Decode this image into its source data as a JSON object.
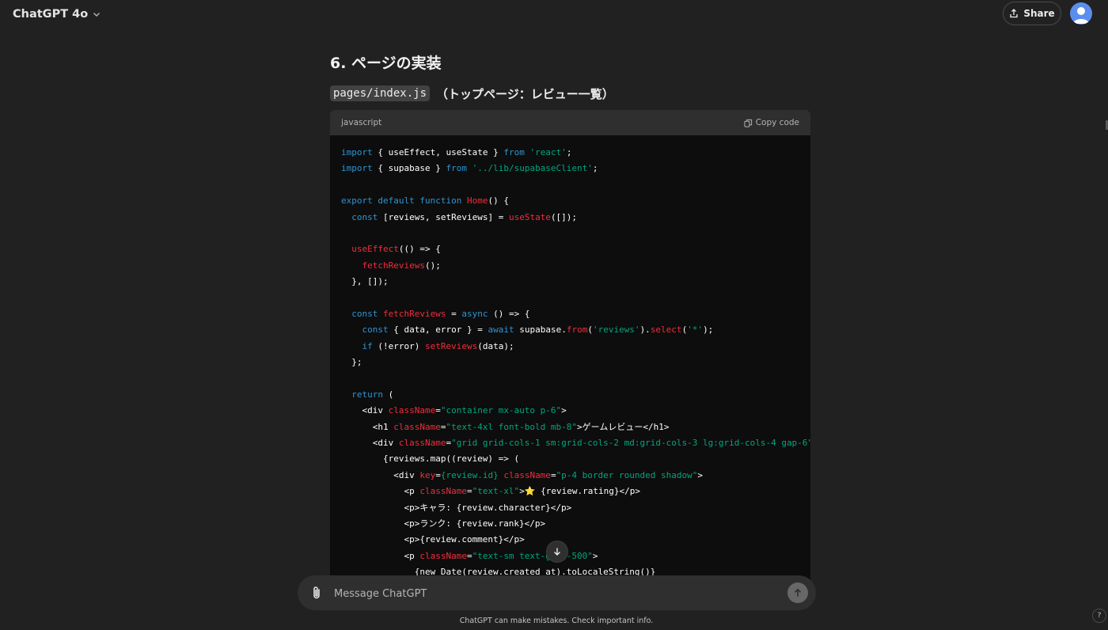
{
  "header": {
    "model_label": "ChatGPT 4o",
    "share_label": "Share"
  },
  "content": {
    "heading": "6. ページの実装",
    "file_name": "pages/index.js",
    "file_desc": "（トップページ：レビュー一覧）",
    "code_block": {
      "language": "javascript",
      "copy_label": "Copy code",
      "lines": [
        [
          [
            "kw",
            "import"
          ],
          [
            "pl",
            " { useEffect, useState } "
          ],
          [
            "kw",
            "from"
          ],
          [
            "pl",
            " "
          ],
          [
            "str",
            "'react'"
          ],
          [
            "pl",
            ";"
          ]
        ],
        [
          [
            "kw",
            "import"
          ],
          [
            "pl",
            " { supabase } "
          ],
          [
            "kw",
            "from"
          ],
          [
            "pl",
            " "
          ],
          [
            "str",
            "'../lib/supabaseClient'"
          ],
          [
            "pl",
            ";"
          ]
        ],
        [],
        [
          [
            "kw",
            "export"
          ],
          [
            "pl",
            " "
          ],
          [
            "kw",
            "default"
          ],
          [
            "pl",
            " "
          ],
          [
            "kw",
            "function"
          ],
          [
            "pl",
            " "
          ],
          [
            "fn",
            "Home"
          ],
          [
            "pl",
            "() {"
          ]
        ],
        [
          [
            "pl",
            "  "
          ],
          [
            "kw",
            "const"
          ],
          [
            "pl",
            " [reviews, setReviews] = "
          ],
          [
            "fn",
            "useState"
          ],
          [
            "pl",
            "([]);"
          ]
        ],
        [],
        [
          [
            "pl",
            "  "
          ],
          [
            "fn",
            "useEffect"
          ],
          [
            "pl",
            "(() => {"
          ]
        ],
        [
          [
            "pl",
            "    "
          ],
          [
            "fn",
            "fetchReviews"
          ],
          [
            "pl",
            "();"
          ]
        ],
        [
          [
            "pl",
            "  }, []);"
          ]
        ],
        [],
        [
          [
            "pl",
            "  "
          ],
          [
            "kw",
            "const"
          ],
          [
            "pl",
            " "
          ],
          [
            "fn",
            "fetchReviews"
          ],
          [
            "pl",
            " = "
          ],
          [
            "kw",
            "async"
          ],
          [
            "pl",
            " () => {"
          ]
        ],
        [
          [
            "pl",
            "    "
          ],
          [
            "kw",
            "const"
          ],
          [
            "pl",
            " { data, error } = "
          ],
          [
            "kw",
            "await"
          ],
          [
            "pl",
            " supabase."
          ],
          [
            "fn",
            "from"
          ],
          [
            "pl",
            "("
          ],
          [
            "str",
            "'reviews'"
          ],
          [
            "pl",
            ")."
          ],
          [
            "fn",
            "select"
          ],
          [
            "pl",
            "("
          ],
          [
            "str",
            "'*'"
          ],
          [
            "pl",
            ");"
          ]
        ],
        [
          [
            "pl",
            "    "
          ],
          [
            "kw",
            "if"
          ],
          [
            "pl",
            " (!error) "
          ],
          [
            "fn",
            "setReviews"
          ],
          [
            "pl",
            "(data);"
          ]
        ],
        [
          [
            "pl",
            "  };"
          ]
        ],
        [],
        [
          [
            "pl",
            "  "
          ],
          [
            "kw",
            "return"
          ],
          [
            "pl",
            " ("
          ]
        ],
        [
          [
            "pl",
            "    <div "
          ],
          [
            "fn",
            "className"
          ],
          [
            "pl",
            "="
          ],
          [
            "str",
            "\"container mx-auto p-6\""
          ],
          [
            "pl",
            ">"
          ]
        ],
        [
          [
            "pl",
            "      <h1 "
          ],
          [
            "fn",
            "className"
          ],
          [
            "pl",
            "="
          ],
          [
            "str",
            "\"text-4xl font-bold mb-8\""
          ],
          [
            "pl",
            ">ゲームレビュー</h1>"
          ]
        ],
        [
          [
            "pl",
            "      <div "
          ],
          [
            "fn",
            "className"
          ],
          [
            "pl",
            "="
          ],
          [
            "str",
            "\"grid grid-cols-1 sm:grid-cols-2 md:grid-cols-3 lg:grid-cols-4 gap-6\""
          ],
          [
            "pl",
            ">"
          ]
        ],
        [
          [
            "pl",
            "        {reviews.map((review) => ("
          ]
        ],
        [
          [
            "pl",
            "          <div "
          ],
          [
            "fn",
            "key"
          ],
          [
            "pl",
            "="
          ],
          [
            "str",
            "{review.id}"
          ],
          [
            "pl",
            " "
          ],
          [
            "fn",
            "className"
          ],
          [
            "pl",
            "="
          ],
          [
            "str",
            "\"p-4 border rounded shadow\""
          ],
          [
            "pl",
            ">"
          ]
        ],
        [
          [
            "pl",
            "            <p "
          ],
          [
            "fn",
            "className"
          ],
          [
            "pl",
            "="
          ],
          [
            "str",
            "\"text-xl\""
          ],
          [
            "pl",
            ">⭐ {review.rating}</p>"
          ]
        ],
        [
          [
            "pl",
            "            <p>キャラ: {review.character}</p>"
          ]
        ],
        [
          [
            "pl",
            "            <p>ランク: {review.rank}</p>"
          ]
        ],
        [
          [
            "pl",
            "            <p>{review.comment}</p>"
          ]
        ],
        [
          [
            "pl",
            "            <p "
          ],
          [
            "fn",
            "className"
          ],
          [
            "pl",
            "="
          ],
          [
            "str",
            "\"text-sm text-gray-500\""
          ],
          [
            "pl",
            ">"
          ]
        ],
        [
          [
            "pl",
            "              {new Date(review.created_at).toLocaleString()}"
          ]
        ]
      ]
    }
  },
  "composer": {
    "placeholder": "Message ChatGPT"
  },
  "footer": {
    "disclaimer": "ChatGPT can make mistakes. Check important info.",
    "help_label": "?"
  },
  "colors": {
    "background": "#212121",
    "code_keyword": "#2e95d3",
    "code_function": "#f22c3d",
    "code_string": "#00a67d",
    "avatar": "#5b8def"
  },
  "icons": [
    "chevron-down-icon",
    "share-icon",
    "avatar",
    "copy-icon",
    "arrow-down-icon",
    "paperclip-icon",
    "arrow-up-icon"
  ]
}
